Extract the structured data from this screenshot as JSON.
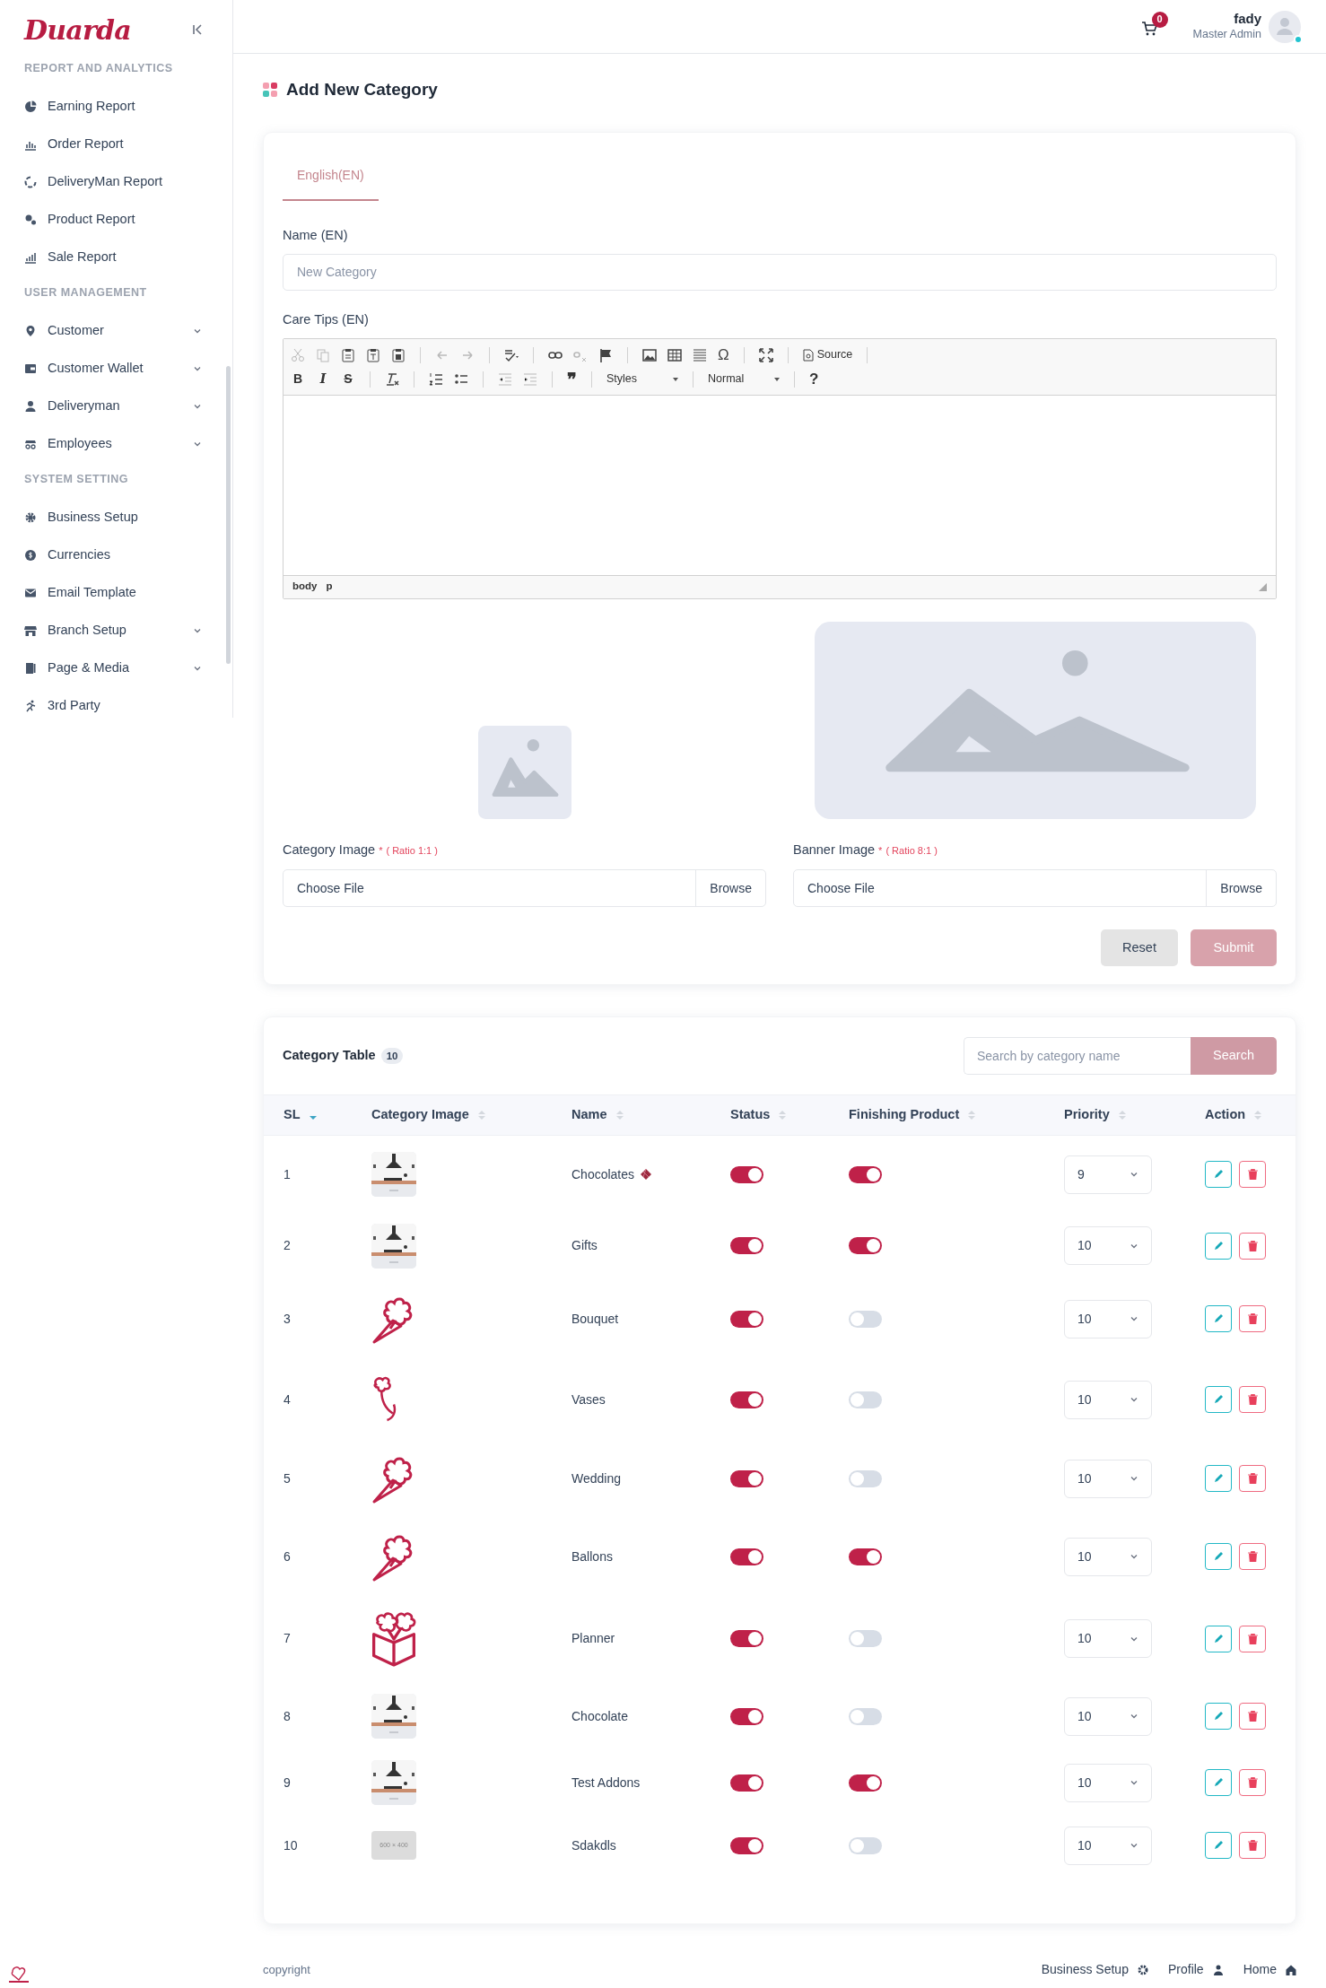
{
  "sidebar": {
    "logo": "Duarda",
    "sections": [
      {
        "title": "REPORT AND ANALYTICS",
        "items": [
          {
            "label": "Earning Report",
            "expandable": false
          },
          {
            "label": "Order Report",
            "expandable": false
          },
          {
            "label": "DeliveryMan Report",
            "expandable": false
          },
          {
            "label": "Product Report",
            "expandable": false
          },
          {
            "label": "Sale Report",
            "expandable": false
          }
        ]
      },
      {
        "title": "USER MANAGEMENT",
        "items": [
          {
            "label": "Customer",
            "expandable": true
          },
          {
            "label": "Customer Wallet",
            "expandable": true
          },
          {
            "label": "Deliveryman",
            "expandable": true
          },
          {
            "label": "Employees",
            "expandable": true
          }
        ]
      },
      {
        "title": "SYSTEM SETTING",
        "items": [
          {
            "label": "Business Setup",
            "expandable": false
          },
          {
            "label": "Currencies",
            "expandable": false
          },
          {
            "label": "Email Template",
            "expandable": false
          },
          {
            "label": "Branch Setup",
            "expandable": true
          },
          {
            "label": "Page & Media",
            "expandable": true
          },
          {
            "label": "3rd Party",
            "expandable": false
          }
        ]
      }
    ]
  },
  "header": {
    "cart_count": "0",
    "user_name": "fady",
    "user_role": "Master Admin",
    "online": true
  },
  "page_title": "Add New Category",
  "form": {
    "tabs": [
      {
        "label": "English(EN)",
        "selected": true
      }
    ],
    "name_label": "Name (EN)",
    "name_placeholder": "New Category",
    "care_label": "Care Tips (EN)",
    "editor": {
      "format_buttons": [
        "B",
        "I",
        "S"
      ],
      "special_char": "Ω",
      "quote": "❞",
      "source": "Source",
      "styles": "Styles",
      "format": "Normal",
      "help": "?",
      "path": [
        "body",
        "p"
      ]
    },
    "uploads": [
      {
        "label": "Category Image",
        "required": "*",
        "ratio": "( Ratio 1:1 )",
        "file_text": "Choose File",
        "browse": "Browse",
        "kind": "square"
      },
      {
        "label": "Banner Image",
        "required": "*",
        "ratio": "( Ratio 8:1 )",
        "file_text": "Choose File",
        "browse": "Browse",
        "kind": "banner"
      }
    ],
    "reset": "Reset",
    "submit": "Submit"
  },
  "table": {
    "title": "Category Table",
    "count": "10",
    "search_placeholder": "Search by category name",
    "search_button": "Search",
    "columns": [
      {
        "label": "SL",
        "sorted": true
      },
      {
        "label": "Category Image",
        "sorted": false
      },
      {
        "label": "Name",
        "sorted": false
      },
      {
        "label": "Status",
        "sorted": false
      },
      {
        "label": "Finishing Product",
        "sorted": false
      },
      {
        "label": "Priority",
        "sorted": false
      },
      {
        "label": "Action",
        "sorted": false
      }
    ],
    "rows": [
      {
        "sl": "1",
        "name": "Chocolates",
        "tagged": true,
        "status": true,
        "finishing": true,
        "priority": "9"
      },
      {
        "sl": "2",
        "name": "Gifts",
        "tagged": false,
        "status": true,
        "finishing": true,
        "priority": "10"
      },
      {
        "sl": "3",
        "image": {
          "kind": "bouquet"
        },
        "name": "Bouquet",
        "tagged": false,
        "status": true,
        "finishing": false,
        "priority": "10"
      },
      {
        "sl": "4",
        "image": {
          "kind": "stem"
        },
        "name": "Vases",
        "tagged": false,
        "status": true,
        "finishing": false,
        "priority": "10"
      },
      {
        "sl": "5",
        "image": {
          "kind": "bouquet"
        },
        "name": "Wedding",
        "tagged": false,
        "status": true,
        "finishing": false,
        "priority": "10"
      },
      {
        "sl": "6",
        "image": {
          "kind": "bouquet"
        },
        "name": "Ballons",
        "tagged": false,
        "status": true,
        "finishing": true,
        "priority": "10"
      },
      {
        "sl": "7",
        "image": {
          "kind": "box"
        },
        "name": "Planner",
        "tagged": false,
        "status": true,
        "finishing": false,
        "priority": "10"
      },
      {
        "sl": "8",
        "name": "Chocolate",
        "tagged": false,
        "status": true,
        "finishing": false,
        "priority": "10"
      },
      {
        "sl": "9",
        "name": "Test Addons",
        "tagged": false,
        "status": true,
        "finishing": true,
        "priority": "10"
      },
      {
        "sl": "10",
        "image": {
          "kind": "placeholder",
          "text": "600 × 400"
        },
        "name": "Sdakdls",
        "tagged": false,
        "status": true,
        "finishing": false,
        "priority": "10"
      }
    ]
  },
  "footer": {
    "copyright": "copyright",
    "links": [
      "Business Setup",
      "Profile",
      "Home"
    ]
  }
}
